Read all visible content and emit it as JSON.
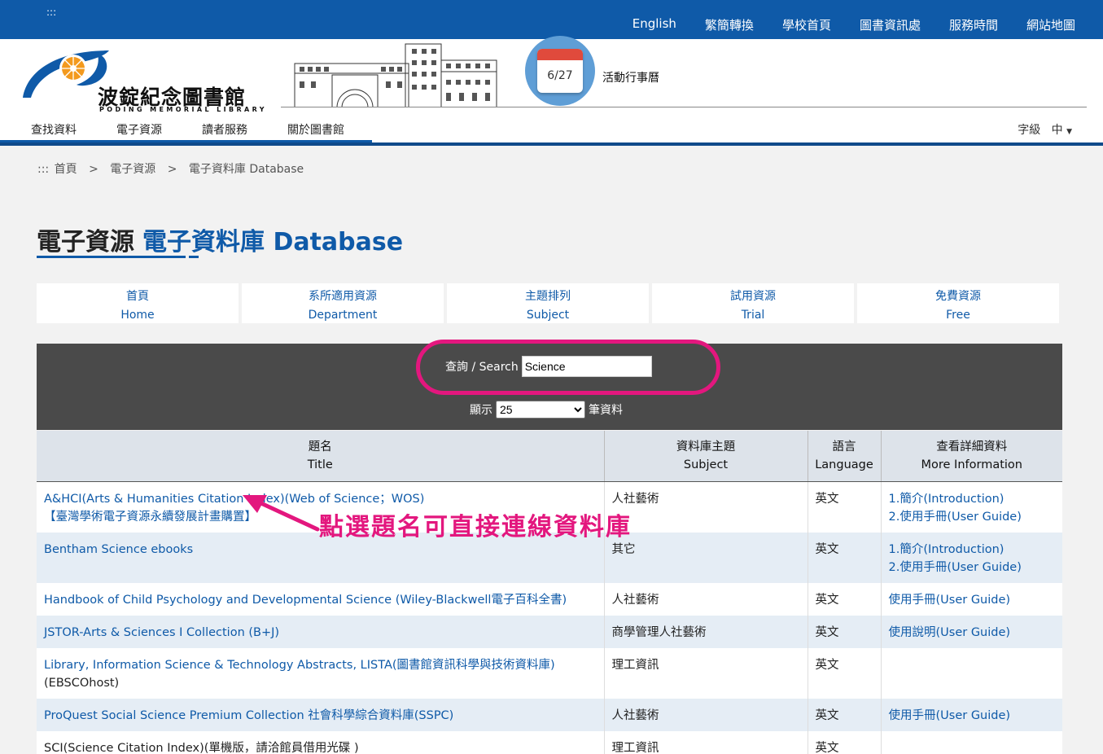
{
  "topbar": {
    "skip": ":::",
    "links": [
      "English",
      "繁簡轉換",
      "學校首頁",
      "圖書資訊處",
      "服務時間",
      "網站地圖"
    ]
  },
  "header": {
    "logo_text": "波錠紀念圖書館",
    "logo_sub": "PODING MEMORIAL LIBRARY",
    "calendar_date": "6/27",
    "event_label": "活動行事曆",
    "nav": [
      "查找資料",
      "電子資源",
      "讀者服務",
      "關於圖書館"
    ],
    "font_size_label": "字級",
    "font_size_value": "中"
  },
  "breadcrumb": {
    "prefix": ":::",
    "items": [
      "首頁",
      "電子資源",
      "電子資料庫 Database"
    ],
    "separator": ">"
  },
  "page_title": {
    "main": "電子資源",
    "sub": "電子資料庫 Database"
  },
  "tabs": [
    {
      "zh": "首頁",
      "en": "Home"
    },
    {
      "zh": "系所適用資源",
      "en": "Department"
    },
    {
      "zh": "主題排列",
      "en": "Subject"
    },
    {
      "zh": "試用資源",
      "en": "Trial"
    },
    {
      "zh": "免費資源",
      "en": "Free"
    }
  ],
  "search": {
    "label": "查詢 / Search",
    "value": "Science",
    "show_label": "顯示",
    "show_value": "25",
    "show_suffix": "筆資料"
  },
  "table": {
    "headers": [
      {
        "zh": "題名",
        "en": "Title"
      },
      {
        "zh": "資料庫主題",
        "en": "Subject"
      },
      {
        "zh": "語言",
        "en": "Language"
      },
      {
        "zh": "查看詳細資料",
        "en": "More Information"
      }
    ],
    "rows": [
      {
        "title": "A&HCI(Arts & Humanities Citation Index)(Web of Science；WOS)",
        "title2": "【臺灣學術電子資源永續發展計畫購置】",
        "subject": "人社藝術",
        "language": "英文",
        "info": [
          "1.簡介(Introduction)",
          "2.使用手冊(User Guide)"
        ]
      },
      {
        "title": "Bentham Science ebooks",
        "title2": "",
        "subject": "其它",
        "language": "英文",
        "info": [
          "1.簡介(Introduction)",
          "2.使用手冊(User Guide)"
        ]
      },
      {
        "title": "Handbook of Child Psychology and Developmental Science (Wiley-Blackwell電子百科全書)",
        "title2": "",
        "subject": "人社藝術",
        "language": "英文",
        "info": [
          "使用手冊(User Guide)"
        ]
      },
      {
        "title": "JSTOR-Arts & Sciences I Collection (B+J)",
        "title2": "",
        "subject": "商學管理人社藝術",
        "language": "英文",
        "info": [
          "使用說明(User Guide)"
        ]
      },
      {
        "title": "Library, Information Science & Technology Abstracts, LISTA(圖書館資訊科學與技術資料庫)",
        "title2": "(EBSCOhost)",
        "subject": "理工資訊",
        "language": "英文",
        "info": []
      },
      {
        "title": "ProQuest Social Science Premium Collection 社會科學綜合資料庫(SSPC)",
        "title2": "",
        "subject": "人社藝術",
        "language": "英文",
        "info": [
          "使用手冊(User Guide)"
        ]
      },
      {
        "title": "SCI(Science Citation Index)(單機版，請洽館員借用光碟 )",
        "title2": "",
        "subject": "理工資訊",
        "language": "英文",
        "info": []
      }
    ]
  },
  "annotation": "點選題名可直接連線資料庫",
  "colors": {
    "brand": "#0f5aa8",
    "highlight": "#e3177e"
  }
}
